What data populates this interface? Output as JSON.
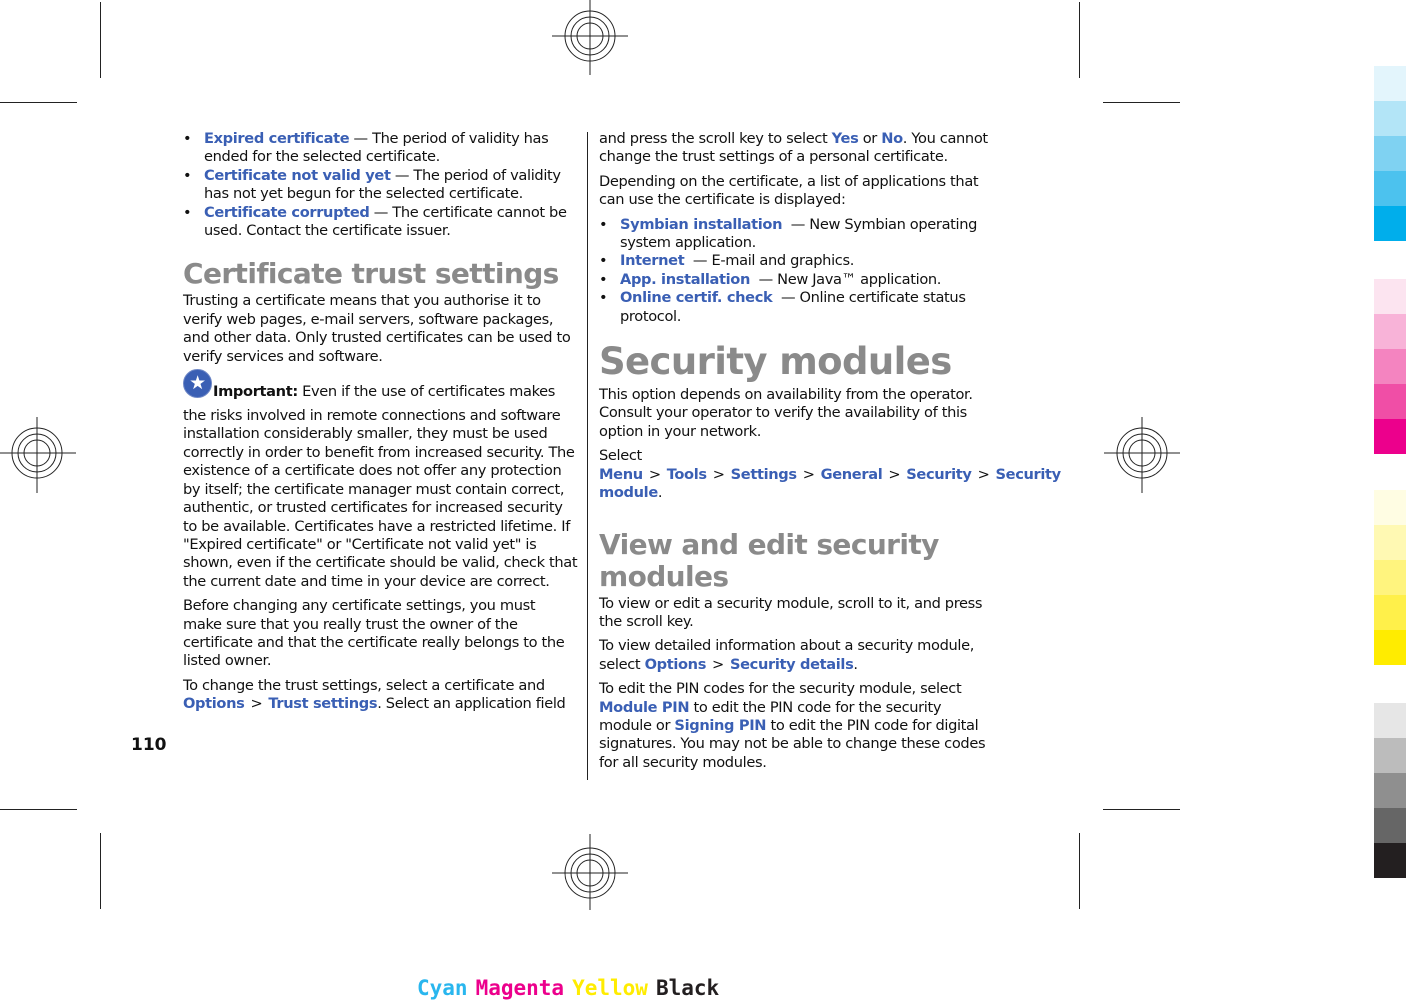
{
  "left_column": {
    "status_bullets": [
      {
        "term": "Expired certificate",
        "desc": " — The period of validity has ended for the selected certificate."
      },
      {
        "term": "Certificate not valid yet",
        "desc": " — The period of validity has not yet begun for the selected certificate."
      },
      {
        "term": "Certificate corrupted",
        "desc": " — The certificate cannot be used. Contact the certificate issuer."
      }
    ],
    "heading": "Certificate trust settings",
    "intro": "Trusting a certificate means that you authorise it to verify web pages, e-mail servers, software packages, and other data. Only trusted certificates can be used to verify services and software.",
    "important": {
      "icon": "star-icon",
      "label": "Important:",
      "text": " Even if the use of certificates makes the risks involved in remote connections and software installation considerably smaller, they must be used correctly in order to benefit from increased security. The existence of a certificate does not offer any protection by itself; the certificate manager must contain correct, authentic, or trusted certificates for increased security to be available. Certificates have a restricted lifetime. If \"Expired certificate\" or \"Certificate not valid yet\" is shown, even if the certificate should be valid, check that the current date and time in your device are correct."
    },
    "before_changing": "Before changing any certificate settings, you must make sure that you really trust the owner of the certificate and that the certificate really belongs to the listed owner.",
    "change_trust": {
      "prefix": "To change the trust settings, select a certificate and ",
      "path": [
        "Options",
        "Trust settings"
      ],
      "suffix": ". Select an application field"
    }
  },
  "right_column": {
    "continuation": {
      "prefix": "and press the scroll key to select ",
      "yes": "Yes",
      "or": " or ",
      "no": "No",
      "suffix": ". You cannot change the trust settings of a personal certificate."
    },
    "depending": "Depending on the certificate, a list of applications that can use the certificate is displayed:",
    "app_bullets": [
      {
        "term": "Symbian installation",
        "desc": "  — New Symbian operating system application."
      },
      {
        "term": "Internet",
        "desc": "  — E-mail and graphics."
      },
      {
        "term": "App. installation",
        "desc": "  — New Java™ application."
      },
      {
        "term": "Online certif. check",
        "desc": "  — Online certificate status protocol."
      }
    ],
    "heading_security": "Security modules",
    "security_intro": "This option depends on availability from the operator. Consult your operator to verify the availability of this option in your network.",
    "select_path": {
      "prefix": "Select ",
      "items": [
        "Menu",
        "Tools",
        "Settings",
        "General",
        "Security",
        "Security module"
      ],
      "suffix": "."
    },
    "heading_view_edit": "View and edit security modules",
    "view_edit_p1": "To view or edit a security module, scroll to it, and press the scroll key.",
    "view_details": {
      "prefix": "To view detailed information about a security module, select ",
      "path": [
        "Options",
        "Security details"
      ],
      "suffix": "."
    },
    "edit_pin": {
      "prefix": "To edit the PIN codes for the security module, select ",
      "module_pin": "Module PIN",
      "mid": " to edit the PIN code for the security module or ",
      "signing_pin": "Signing PIN",
      "suffix": " to edit the PIN code for digital signatures. You may not be able to change these codes for all security modules."
    }
  },
  "page_number": "110",
  "separator": ">",
  "colors": {
    "link": "#3a5fb4",
    "heading": "#8a8a8a",
    "swatches": [
      "#e3f5fc",
      "#b3e5f7",
      "#7fd2f2",
      "#4cc2ee",
      "#00aeeb",
      "#fce4f0",
      "#f8b3d8",
      "#f484c0",
      "#f04ea6",
      "#ec008c",
      "#fffde3",
      "#fff9b3",
      "#fff47e",
      "#fff04a",
      "#ffec00",
      "#e6e6e6",
      "#bcbcbc",
      "#8f8f8f",
      "#666666",
      "#231f20"
    ]
  },
  "cmyk_labels": [
    {
      "text": "Cyan",
      "color": "#29b6ee"
    },
    {
      "text": "Magenta",
      "color": "#ec008c"
    },
    {
      "text": "Yellow",
      "color": "#ffec00"
    },
    {
      "text": "Black",
      "color": "#231f20"
    }
  ]
}
